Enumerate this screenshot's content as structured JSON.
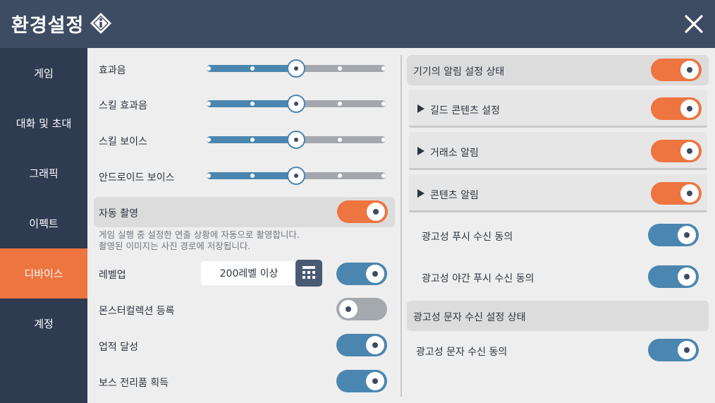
{
  "header": {
    "title": "환경설정"
  },
  "sidebar": {
    "items": [
      {
        "label": "게임"
      },
      {
        "label": "대화 및 초대"
      },
      {
        "label": "그래픽"
      },
      {
        "label": "이펙트"
      },
      {
        "label": "디바이스"
      },
      {
        "label": "계정"
      }
    ],
    "active_index": 4
  },
  "left": {
    "sliders": [
      {
        "label": "효과음",
        "value": 0.5
      },
      {
        "label": "스킬 효과음",
        "value": 0.5
      },
      {
        "label": "스킬 보이스",
        "value": 0.5
      },
      {
        "label": "안드로이드 보이스",
        "value": 0.5
      }
    ],
    "auto_capture": {
      "label": "자동 촬영",
      "on": true,
      "desc_line1": "게임 실행 중 설정한 연출 상황에 자동으로 촬영합니다.",
      "desc_line2": "촬영된 이미지는 사진 경로에 저장됩니다."
    },
    "levelup": {
      "label": "레벨업",
      "value": "200레벨 이상",
      "on": true
    },
    "monster": {
      "label": "몬스터컬렉션 등록",
      "on": false
    },
    "achievement": {
      "label": "업적 달성",
      "on": true
    },
    "boss": {
      "label": "보스 전리품 획득",
      "on": true
    }
  },
  "right": {
    "device_alert": {
      "label": "기기의 알림 설정 상태",
      "on": true
    },
    "guild": {
      "label": "길드 콘텐츠 설정",
      "on": true
    },
    "market": {
      "label": "거래소 알림",
      "on": true
    },
    "content": {
      "label": "콘텐츠 알림",
      "on": true
    },
    "push": {
      "label": "광고성 푸시 수신 동의",
      "on": true
    },
    "night_push": {
      "label": "광고성 야간 푸시 수신 동의",
      "on": true
    },
    "sms_status": {
      "label": "광고성 문자 수신 설정 상태"
    },
    "sms_agree": {
      "label": "광고성 문자 수신 동의",
      "on": true
    }
  },
  "colors": {
    "header": "#3d4b63",
    "sidebar": "#2f3b51",
    "accent_orange": "#ee7440",
    "accent_blue": "#4b86b0",
    "toggle_off": "#a4a9ae"
  },
  "icons": [
    "info-icon",
    "close-icon",
    "calculator-icon",
    "play-icon"
  ]
}
